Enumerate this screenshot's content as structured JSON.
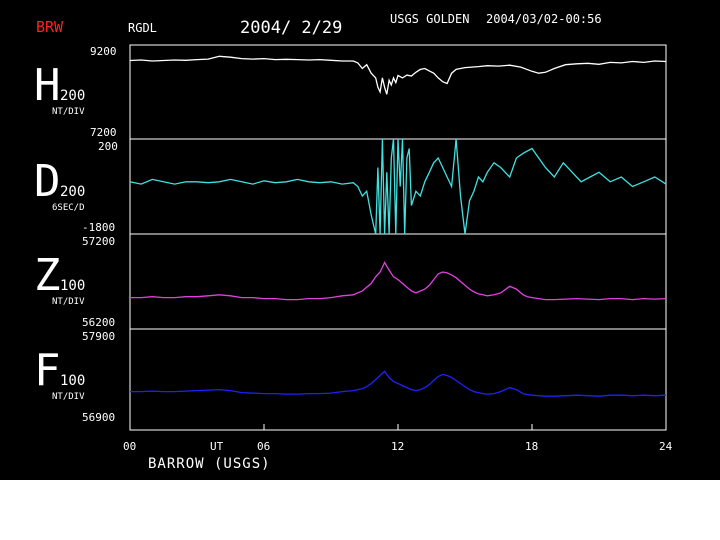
{
  "header": {
    "observatory": "BRW",
    "code": "RGDL",
    "date": "2004/ 2/29",
    "source": "USGS GOLDEN",
    "timestamp": "2004/03/02-00:56"
  },
  "site_label": "BARROW (USGS)",
  "colors": {
    "background": "#000000",
    "frame": "#ffffff",
    "H": "#ffffff",
    "D": "#40e0e0",
    "Z": "#e040e0",
    "F": "#2020ff",
    "observatory": "#ff2020"
  },
  "chart_data": {
    "type": "line",
    "x_axis": {
      "ticks": [
        {
          "value": 0,
          "label": "00"
        },
        {
          "value": 6,
          "label": "06"
        },
        {
          "value": 12,
          "label": "12"
        },
        {
          "value": 18,
          "label": "18"
        },
        {
          "value": 24,
          "label": "24"
        }
      ],
      "unit_label": "UT",
      "range": [
        0,
        24
      ]
    },
    "panels": [
      {
        "component": "H",
        "scale": "200",
        "unit": "NT/DIV",
        "top_label": "9200",
        "bottom_label": "7200",
        "ylim": [
          7200,
          9200
        ],
        "x": [
          0,
          0.5,
          1,
          1.5,
          2,
          2.5,
          3,
          3.5,
          4,
          4.5,
          5,
          5.5,
          6,
          6.5,
          7,
          7.5,
          8,
          8.5,
          9,
          9.5,
          10,
          10.2,
          10.4,
          10.6,
          10.8,
          11,
          11.1,
          11.2,
          11.3,
          11.4,
          11.5,
          11.6,
          11.7,
          11.8,
          11.9,
          12,
          12.2,
          12.4,
          12.6,
          12.8,
          13,
          13.2,
          13.4,
          13.6,
          13.8,
          14,
          14.2,
          14.4,
          14.6,
          14.8,
          15,
          15.3,
          15.6,
          16,
          16.5,
          17,
          17.5,
          18,
          18.3,
          18.6,
          19,
          19.5,
          20,
          20.5,
          21,
          21.5,
          22,
          22.5,
          23,
          23.5,
          24
        ],
        "y": [
          8870,
          8880,
          8860,
          8870,
          8880,
          8875,
          8890,
          8900,
          8960,
          8940,
          8910,
          8900,
          8910,
          8890,
          8895,
          8890,
          8880,
          8890,
          8875,
          8860,
          8860,
          8820,
          8700,
          8780,
          8600,
          8500,
          8300,
          8200,
          8500,
          8300,
          8150,
          8450,
          8350,
          8500,
          8400,
          8550,
          8500,
          8560,
          8540,
          8620,
          8680,
          8700,
          8650,
          8600,
          8500,
          8420,
          8380,
          8600,
          8680,
          8700,
          8720,
          8730,
          8740,
          8760,
          8750,
          8770,
          8730,
          8640,
          8600,
          8620,
          8700,
          8780,
          8800,
          8810,
          8790,
          8830,
          8820,
          8850,
          8830,
          8860,
          8850
        ]
      },
      {
        "component": "D",
        "scale": "200",
        "unit": "6SEC/D",
        "top_label": "200",
        "bottom_label": "-1800",
        "ylim": [
          -1800,
          200
        ],
        "x": [
          0,
          0.5,
          1,
          1.5,
          2,
          2.5,
          3,
          3.5,
          4,
          4.5,
          5,
          5.5,
          6,
          6.5,
          7,
          7.5,
          8,
          8.5,
          9,
          9.5,
          10,
          10.2,
          10.4,
          10.6,
          10.8,
          11,
          11.1,
          11.2,
          11.3,
          11.4,
          11.5,
          11.6,
          11.7,
          11.8,
          11.9,
          12,
          12.1,
          12.2,
          12.3,
          12.4,
          12.5,
          12.6,
          12.8,
          13,
          13.2,
          13.4,
          13.6,
          13.8,
          14,
          14.2,
          14.4,
          14.6,
          14.8,
          15,
          15.2,
          15.4,
          15.6,
          15.8,
          16,
          16.3,
          16.6,
          17,
          17.3,
          17.6,
          18,
          18.3,
          18.6,
          19,
          19.4,
          19.8,
          20.2,
          20.6,
          21,
          21.5,
          22,
          22.5,
          23,
          23.5,
          24
        ],
        "y": [
          -700,
          -750,
          -650,
          -700,
          -750,
          -700,
          -700,
          -720,
          -700,
          -650,
          -700,
          -750,
          -680,
          -720,
          -700,
          -650,
          -700,
          -720,
          -700,
          -750,
          -720,
          -800,
          -1000,
          -900,
          -1400,
          -1800,
          -400,
          -1800,
          200,
          -1800,
          -500,
          -1800,
          -200,
          200,
          -1800,
          200,
          -800,
          200,
          -1800,
          -200,
          0,
          -1200,
          -900,
          -1000,
          -700,
          -500,
          -300,
          -200,
          -400,
          -600,
          -800,
          200,
          -1000,
          -1800,
          -1100,
          -900,
          -600,
          -700,
          -500,
          -300,
          -400,
          -600,
          -200,
          -100,
          0,
          -200,
          -400,
          -600,
          -300,
          -500,
          -700,
          -600,
          -500,
          -700,
          -600,
          -800,
          -700,
          -600,
          -750
        ]
      },
      {
        "component": "Z",
        "scale": "100",
        "unit": "NT/DIV",
        "top_label": "57200",
        "bottom_label": "56200",
        "ylim": [
          56200,
          57200
        ],
        "x": [
          0,
          0.5,
          1,
          1.5,
          2,
          2.5,
          3,
          3.5,
          4,
          4.5,
          5,
          5.5,
          6,
          6.5,
          7,
          7.5,
          8,
          8.5,
          9,
          9.5,
          10,
          10.2,
          10.4,
          10.6,
          10.8,
          11,
          11.2,
          11.4,
          11.6,
          11.8,
          12,
          12.2,
          12.4,
          12.6,
          12.8,
          13,
          13.2,
          13.4,
          13.6,
          13.8,
          14,
          14.2,
          14.4,
          14.6,
          14.8,
          15,
          15.2,
          15.4,
          15.6,
          15.8,
          16,
          16.3,
          16.6,
          17,
          17.3,
          17.6,
          17.8,
          18,
          18.3,
          18.6,
          19,
          19.5,
          20,
          20.5,
          21,
          21.5,
          22,
          22.5,
          23,
          23.5,
          24
        ],
        "y": [
          56530,
          56530,
          56540,
          56530,
          56530,
          56540,
          56540,
          56550,
          56560,
          56550,
          56530,
          56530,
          56520,
          56520,
          56510,
          56510,
          56520,
          56520,
          56530,
          56550,
          56560,
          56580,
          56600,
          56640,
          56680,
          56750,
          56800,
          56900,
          56820,
          56750,
          56720,
          56680,
          56640,
          56600,
          56580,
          56600,
          56620,
          56660,
          56720,
          56780,
          56800,
          56790,
          56770,
          56740,
          56700,
          56660,
          56620,
          56590,
          56570,
          56560,
          56550,
          56560,
          56580,
          56650,
          56620,
          56560,
          56540,
          56530,
          56520,
          56510,
          56510,
          56515,
          56520,
          56515,
          56510,
          56520,
          56520,
          56510,
          56520,
          56515,
          56520
        ]
      },
      {
        "component": "F",
        "scale": "100",
        "unit": "NT/DIV",
        "top_label": "57900",
        "bottom_label": "56900",
        "ylim": [
          56900,
          57900
        ],
        "x": [
          0,
          0.5,
          1,
          1.5,
          2,
          2.5,
          3,
          3.5,
          4,
          4.5,
          5,
          5.5,
          6,
          6.5,
          7,
          7.5,
          8,
          8.5,
          9,
          9.5,
          10,
          10.2,
          10.4,
          10.6,
          10.8,
          11,
          11.2,
          11.4,
          11.6,
          11.8,
          12,
          12.2,
          12.4,
          12.6,
          12.8,
          13,
          13.2,
          13.4,
          13.6,
          13.8,
          14,
          14.2,
          14.4,
          14.6,
          14.8,
          15,
          15.2,
          15.4,
          15.6,
          15.8,
          16,
          16.3,
          16.6,
          17,
          17.3,
          17.6,
          17.8,
          18,
          18.3,
          18.6,
          19,
          19.5,
          20,
          20.5,
          21,
          21.5,
          22,
          22.5,
          23,
          23.5,
          24
        ],
        "y": [
          57280,
          57280,
          57285,
          57280,
          57280,
          57285,
          57290,
          57295,
          57300,
          57290,
          57270,
          57265,
          57260,
          57260,
          57255,
          57255,
          57260,
          57260,
          57265,
          57280,
          57290,
          57300,
          57310,
          57330,
          57360,
          57400,
          57440,
          57480,
          57420,
          57380,
          57360,
          57340,
          57320,
          57300,
          57290,
          57300,
          57320,
          57350,
          57390,
          57430,
          57450,
          57440,
          57420,
          57390,
          57360,
          57330,
          57300,
          57280,
          57270,
          57260,
          57255,
          57260,
          57280,
          57320,
          57300,
          57260,
          57250,
          57245,
          57240,
          57235,
          57235,
          57240,
          57245,
          57240,
          57235,
          57245,
          57245,
          57240,
          57245,
          57240,
          57245
        ]
      }
    ]
  }
}
